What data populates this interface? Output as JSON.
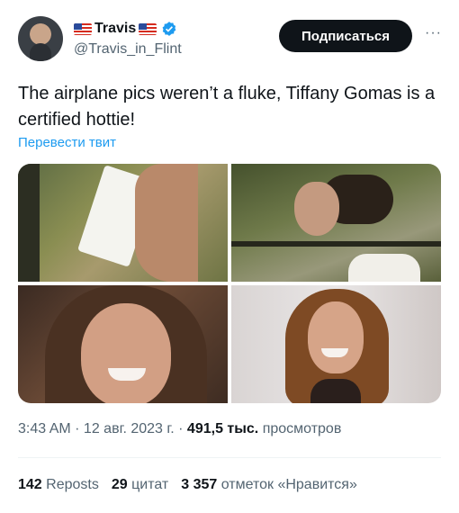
{
  "user": {
    "display_name": "Travis",
    "handle": "@Travis_in_Flint",
    "flag_icon": "us-flag-icon",
    "verified_color": "#1d9bf0"
  },
  "actions": {
    "subscribe_label": "Подписаться",
    "more_label": "···"
  },
  "tweet": {
    "text": "The airplane pics weren’t a fluke, Tiffany Gomas is a certified hottie!",
    "translate_label": "Перевести твит"
  },
  "meta": {
    "time": "3:43 AM",
    "sep1": " · ",
    "date": "12 авг. 2023 г.",
    "sep2": " · ",
    "views_count": "491,5 тыс.",
    "views_label": " просмотров"
  },
  "stats": {
    "reposts_count": "142",
    "reposts_label": " Reposts",
    "quotes_count": "29",
    "quotes_label": " цитат",
    "likes_count": "3 357",
    "likes_label": " отметок «Нравится»"
  },
  "colors": {
    "accent": "#1d9bf0",
    "text": "#0f1419",
    "muted": "#536471"
  }
}
